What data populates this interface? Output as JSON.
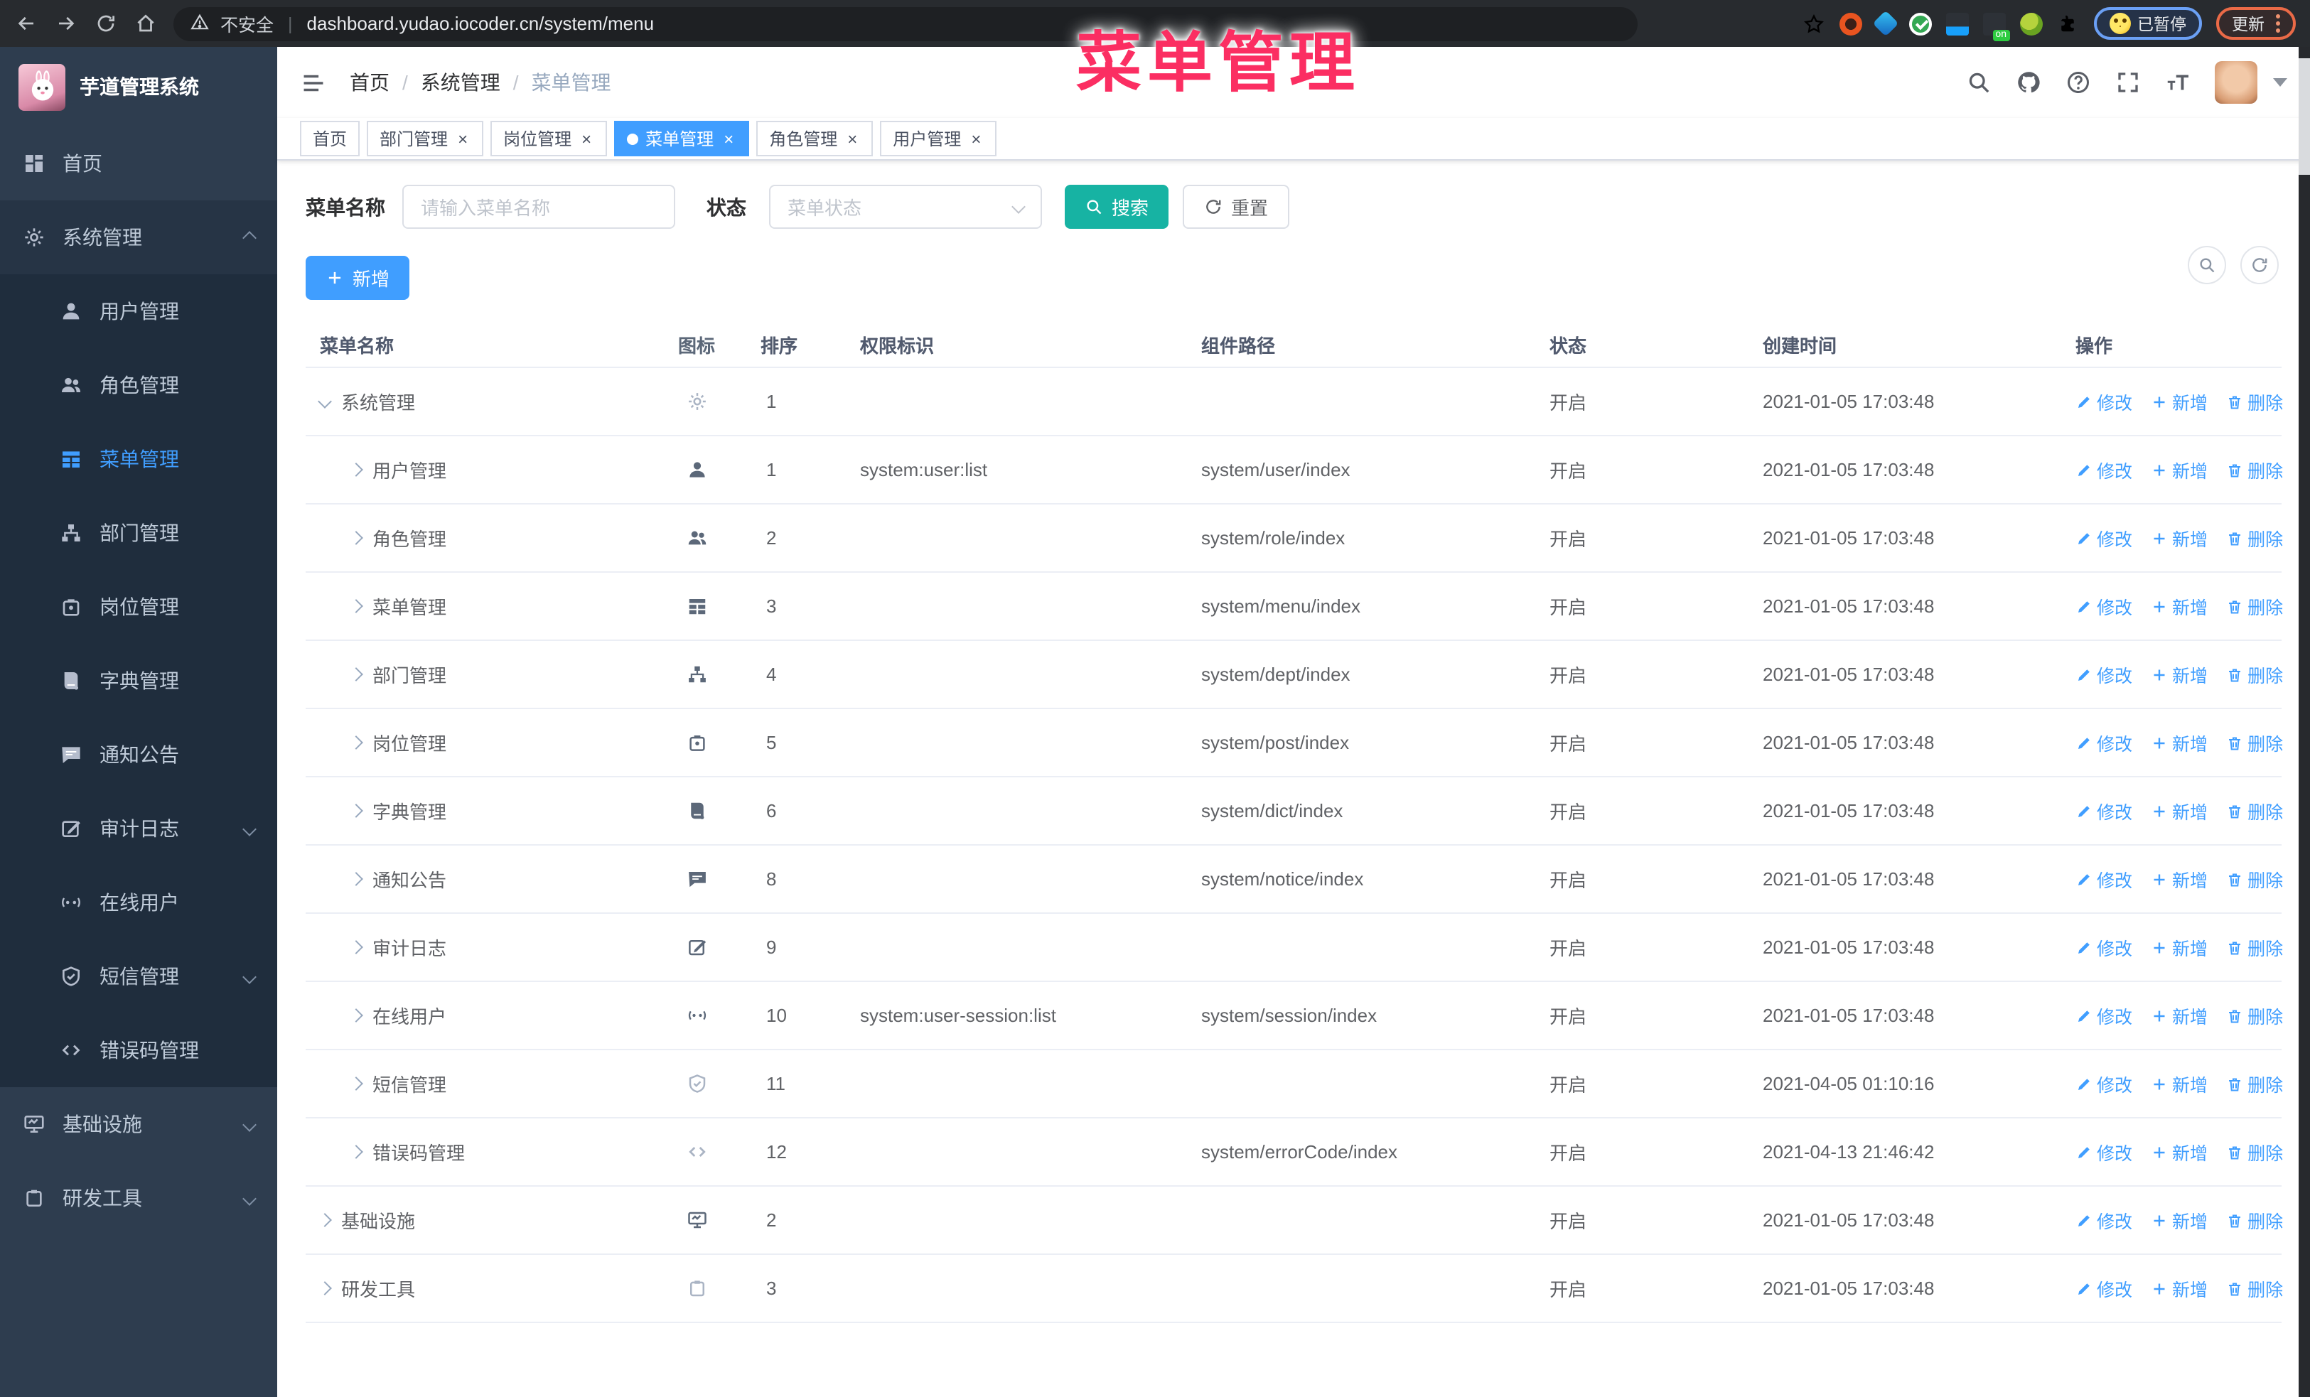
{
  "browser": {
    "security_label": "不安全",
    "url": "dashboard.yudao.iocoder.cn/system/menu",
    "paused_badge": "已暂停",
    "update_button": "更新",
    "nav_icons": [
      "back-arrow",
      "forward-arrow",
      "reload",
      "home"
    ],
    "extension_icons": [
      "bookmark-star",
      "ubuntu",
      "gem",
      "verified-check",
      "grid",
      "on-badge",
      "key",
      "puzzle"
    ]
  },
  "overlay_title": "菜单管理",
  "sidebar": {
    "logo_title": "芋道管理系统",
    "items": [
      {
        "key": "home",
        "label": "首页",
        "icon": "dashboard",
        "type": "top"
      },
      {
        "key": "system",
        "label": "系统管理",
        "icon": "gear",
        "type": "top",
        "caret": "up",
        "highlight": true
      },
      {
        "key": "user",
        "label": "用户管理",
        "icon": "user",
        "type": "sub"
      },
      {
        "key": "role",
        "label": "角色管理",
        "icon": "users",
        "type": "sub"
      },
      {
        "key": "menu",
        "label": "菜单管理",
        "icon": "menu",
        "type": "sub",
        "active": true
      },
      {
        "key": "dept",
        "label": "部门管理",
        "icon": "tree",
        "type": "sub"
      },
      {
        "key": "post",
        "label": "岗位管理",
        "icon": "badge",
        "type": "sub"
      },
      {
        "key": "dict",
        "label": "字典管理",
        "icon": "book",
        "type": "sub"
      },
      {
        "key": "notice",
        "label": "通知公告",
        "icon": "message",
        "type": "sub"
      },
      {
        "key": "audit",
        "label": "审计日志",
        "icon": "edit",
        "type": "sub",
        "caret": "down"
      },
      {
        "key": "online",
        "label": "在线用户",
        "icon": "online",
        "type": "sub"
      },
      {
        "key": "sms",
        "label": "短信管理",
        "icon": "shield",
        "type": "sub",
        "caret": "down"
      },
      {
        "key": "errcode",
        "label": "错误码管理",
        "icon": "code",
        "type": "sub"
      },
      {
        "key": "infra",
        "label": "基础设施",
        "icon": "monitor",
        "type": "top",
        "caret": "down"
      },
      {
        "key": "devtool",
        "label": "研发工具",
        "icon": "tool",
        "type": "top",
        "caret": "down"
      }
    ]
  },
  "header": {
    "breadcrumb": [
      "首页",
      "系统管理",
      "菜单管理"
    ],
    "right_icons": [
      "search-icon",
      "github-icon",
      "question-icon",
      "fullscreen-icon",
      "font-size-icon",
      "avatar",
      "caret-down-icon"
    ]
  },
  "tabs": [
    {
      "label": "首页",
      "closable": false,
      "active": false
    },
    {
      "label": "部门管理",
      "closable": true,
      "active": false
    },
    {
      "label": "岗位管理",
      "closable": true,
      "active": false
    },
    {
      "label": "菜单管理",
      "closable": true,
      "active": true
    },
    {
      "label": "角色管理",
      "closable": true,
      "active": false
    },
    {
      "label": "用户管理",
      "closable": true,
      "active": false
    }
  ],
  "filters": {
    "name_label": "菜单名称",
    "name_placeholder": "请输入菜单名称",
    "status_label": "状态",
    "status_placeholder": "菜单状态",
    "search_label": "搜索",
    "reset_label": "重置",
    "add_label": "新增"
  },
  "table": {
    "columns": [
      "菜单名称",
      "图标",
      "排序",
      "权限标识",
      "组件路径",
      "状态",
      "创建时间",
      "操作"
    ],
    "op_labels": [
      {
        "label": "修改",
        "icon": "pencil"
      },
      {
        "label": "新增",
        "icon": "plus"
      },
      {
        "label": "删除",
        "icon": "trash"
      }
    ],
    "rows": [
      {
        "name": "系统管理",
        "level": 0,
        "expanded": true,
        "icon": "gear",
        "icon_light": true,
        "sort": "1",
        "perm": "",
        "path": "",
        "status": "开启",
        "time": "2021-01-05 17:03:48"
      },
      {
        "name": "用户管理",
        "level": 1,
        "expanded": false,
        "icon": "user",
        "icon_light": false,
        "sort": "1",
        "perm": "system:user:list",
        "path": "system/user/index",
        "status": "开启",
        "time": "2021-01-05 17:03:48"
      },
      {
        "name": "角色管理",
        "level": 1,
        "expanded": false,
        "icon": "users",
        "icon_light": false,
        "sort": "2",
        "perm": "",
        "path": "system/role/index",
        "status": "开启",
        "time": "2021-01-05 17:03:48"
      },
      {
        "name": "菜单管理",
        "level": 1,
        "expanded": false,
        "icon": "menu",
        "icon_light": false,
        "sort": "3",
        "perm": "",
        "path": "system/menu/index",
        "status": "开启",
        "time": "2021-01-05 17:03:48"
      },
      {
        "name": "部门管理",
        "level": 1,
        "expanded": false,
        "icon": "tree",
        "icon_light": false,
        "sort": "4",
        "perm": "",
        "path": "system/dept/index",
        "status": "开启",
        "time": "2021-01-05 17:03:48"
      },
      {
        "name": "岗位管理",
        "level": 1,
        "expanded": false,
        "icon": "badge",
        "icon_light": false,
        "sort": "5",
        "perm": "",
        "path": "system/post/index",
        "status": "开启",
        "time": "2021-01-05 17:03:48"
      },
      {
        "name": "字典管理",
        "level": 1,
        "expanded": false,
        "icon": "book",
        "icon_light": false,
        "sort": "6",
        "perm": "",
        "path": "system/dict/index",
        "status": "开启",
        "time": "2021-01-05 17:03:48"
      },
      {
        "name": "通知公告",
        "level": 1,
        "expanded": false,
        "icon": "message",
        "icon_light": false,
        "sort": "8",
        "perm": "",
        "path": "system/notice/index",
        "status": "开启",
        "time": "2021-01-05 17:03:48"
      },
      {
        "name": "审计日志",
        "level": 1,
        "expanded": false,
        "icon": "edit",
        "icon_light": false,
        "sort": "9",
        "perm": "",
        "path": "",
        "status": "开启",
        "time": "2021-01-05 17:03:48"
      },
      {
        "name": "在线用户",
        "level": 1,
        "expanded": false,
        "icon": "online",
        "icon_light": false,
        "sort": "10",
        "perm": "system:user-session:list",
        "path": "system/session/index",
        "status": "开启",
        "time": "2021-01-05 17:03:48"
      },
      {
        "name": "短信管理",
        "level": 1,
        "expanded": false,
        "icon": "shield",
        "icon_light": true,
        "sort": "11",
        "perm": "",
        "path": "",
        "status": "开启",
        "time": "2021-04-05 01:10:16"
      },
      {
        "name": "错误码管理",
        "level": 1,
        "expanded": false,
        "icon": "code",
        "icon_light": true,
        "sort": "12",
        "perm": "",
        "path": "system/errorCode/index",
        "status": "开启",
        "time": "2021-04-13 21:46:42"
      },
      {
        "name": "基础设施",
        "level": 0,
        "expanded": false,
        "icon": "monitor",
        "icon_light": false,
        "sort": "2",
        "perm": "",
        "path": "",
        "status": "开启",
        "time": "2021-01-05 17:03:48"
      },
      {
        "name": "研发工具",
        "level": 0,
        "expanded": false,
        "icon": "tool",
        "icon_light": true,
        "sort": "3",
        "perm": "",
        "path": "",
        "status": "开启",
        "time": "2021-01-05 17:03:48"
      }
    ]
  },
  "colors": {
    "accent_blue": "#409eff",
    "search_teal": "#17b3a3",
    "sidebar_bg": "#2e3d4f",
    "submenu_bg": "#1f2d3d",
    "overlay_pink": "#fb2e62",
    "chrome_bg": "#282b2f"
  }
}
